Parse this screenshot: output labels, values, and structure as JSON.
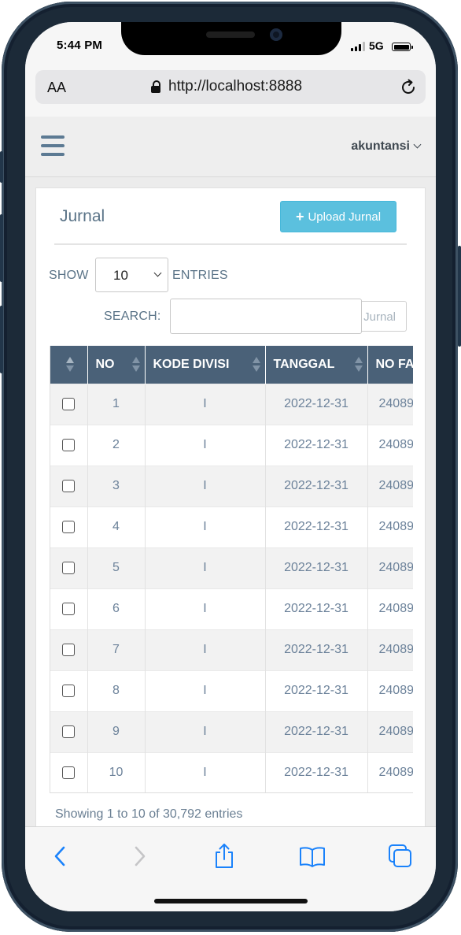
{
  "status_bar": {
    "time": "5:44 PM",
    "network": "5G"
  },
  "browser": {
    "text_size_label": "AA",
    "url": "http://localhost:8888"
  },
  "navbar": {
    "user": "akuntansi"
  },
  "panel": {
    "title": "Jurnal",
    "upload_button": "Upload Jurnal",
    "show_label": "SHOW",
    "entries_label": "ENTRIES",
    "entries_value": "10",
    "search_label": "SEARCH:",
    "search_value": "",
    "search_button_text": "Cari Jurnal"
  },
  "table": {
    "columns": [
      "",
      "NO",
      "KODE DIVISI",
      "TANGGAL",
      "NO FAKTUR"
    ],
    "rows": [
      {
        "no": "1",
        "kode_divisi": "I",
        "tanggal": "2022-12-31",
        "no_faktur": "24089"
      },
      {
        "no": "2",
        "kode_divisi": "I",
        "tanggal": "2022-12-31",
        "no_faktur": "24089"
      },
      {
        "no": "3",
        "kode_divisi": "I",
        "tanggal": "2022-12-31",
        "no_faktur": "24089"
      },
      {
        "no": "4",
        "kode_divisi": "I",
        "tanggal": "2022-12-31",
        "no_faktur": "24089"
      },
      {
        "no": "5",
        "kode_divisi": "I",
        "tanggal": "2022-12-31",
        "no_faktur": "24089"
      },
      {
        "no": "6",
        "kode_divisi": "I",
        "tanggal": "2022-12-31",
        "no_faktur": "24089"
      },
      {
        "no": "7",
        "kode_divisi": "I",
        "tanggal": "2022-12-31",
        "no_faktur": "24089"
      },
      {
        "no": "8",
        "kode_divisi": "I",
        "tanggal": "2022-12-31",
        "no_faktur": "24089"
      },
      {
        "no": "9",
        "kode_divisi": "I",
        "tanggal": "2022-12-31",
        "no_faktur": "24089"
      },
      {
        "no": "10",
        "kode_divisi": "I",
        "tanggal": "2022-12-31",
        "no_faktur": "24089"
      }
    ]
  },
  "footer_info": "Showing 1 to 10 of 30,792 entries",
  "toolbar": {
    "icons": [
      "back-icon",
      "forward-icon",
      "share-icon",
      "bookmarks-icon",
      "tabs-icon"
    ]
  },
  "colors": {
    "accent": "#5bc0de",
    "table_header": "#4a6178",
    "text_muted": "#5a7387",
    "ios_blue": "#1a82fb"
  }
}
